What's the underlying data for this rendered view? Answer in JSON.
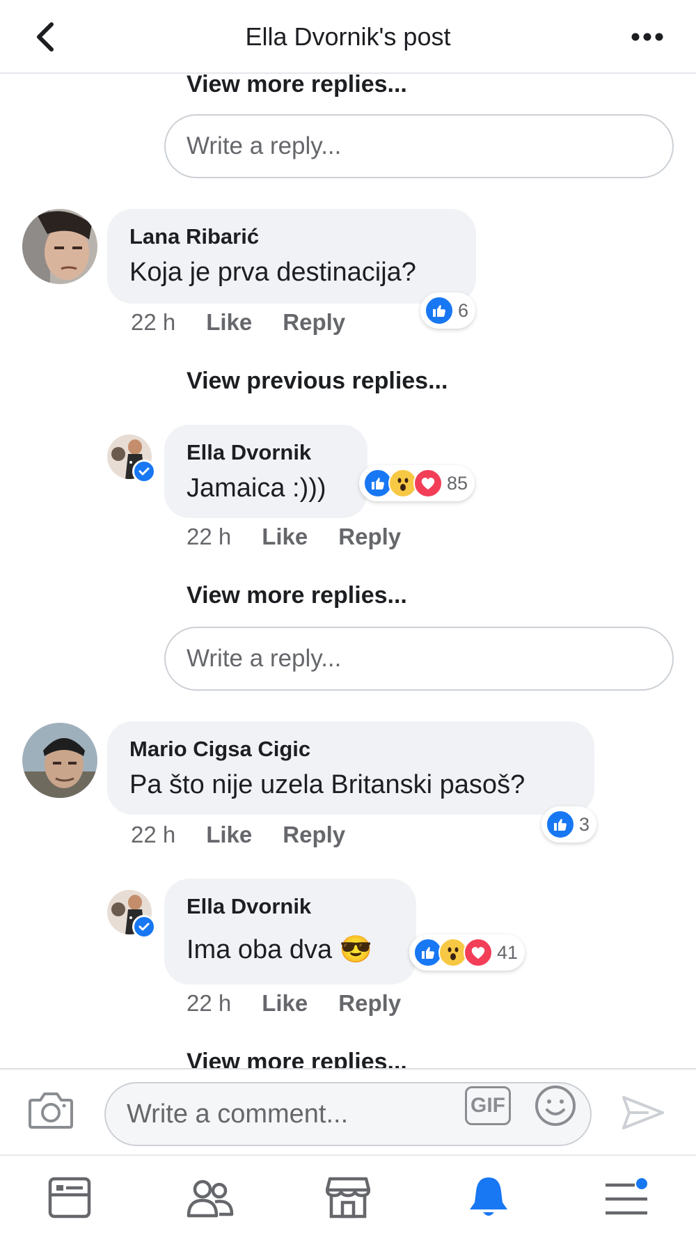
{
  "header": {
    "title": "Ella Dvornik's post"
  },
  "thread1": {
    "view_more_label": "View more replies...",
    "reply_placeholder": "Write a reply..."
  },
  "comment_lana": {
    "author": "Lana Ribarić",
    "text": "Koja je prva destinacija?",
    "time": "22 h",
    "like_label": "Like",
    "reply_label": "Reply",
    "reaction_count": "6",
    "reactions": [
      "like"
    ],
    "view_previous_label": "View previous replies..."
  },
  "reply_ella_1": {
    "author": "Ella Dvornik",
    "text": "Jamaica :)))",
    "time": "22 h",
    "like_label": "Like",
    "reply_label": "Reply",
    "reaction_count": "85",
    "reactions": [
      "like",
      "wow",
      "love"
    ]
  },
  "thread2": {
    "view_more_label": "View more replies...",
    "reply_placeholder": "Write a reply..."
  },
  "comment_mario": {
    "author": "Mario Cigsa Cigic",
    "text": "Pa što nije uzela Britanski pasoš?",
    "time": "22 h",
    "like_label": "Like",
    "reply_label": "Reply",
    "reaction_count": "3",
    "reactions": [
      "like"
    ]
  },
  "reply_ella_2": {
    "author": "Ella Dvornik",
    "text": "Ima oba dva",
    "emoji": "😎",
    "time": "22 h",
    "like_label": "Like",
    "reply_label": "Reply",
    "reaction_count": "41",
    "reactions": [
      "like",
      "wow",
      "love"
    ]
  },
  "thread3": {
    "view_more_label": "View more replies..."
  },
  "composer": {
    "placeholder": "Write a comment...",
    "gif_label": "GIF"
  },
  "tabbar": {
    "tabs": [
      "news-feed",
      "friends",
      "marketplace",
      "notifications",
      "menu"
    ],
    "active": "notifications",
    "active_color": "#1877f2"
  },
  "colors": {
    "accent": "#1877f2",
    "bubble": "#f0f2f5",
    "secondary_text": "#65676b"
  }
}
